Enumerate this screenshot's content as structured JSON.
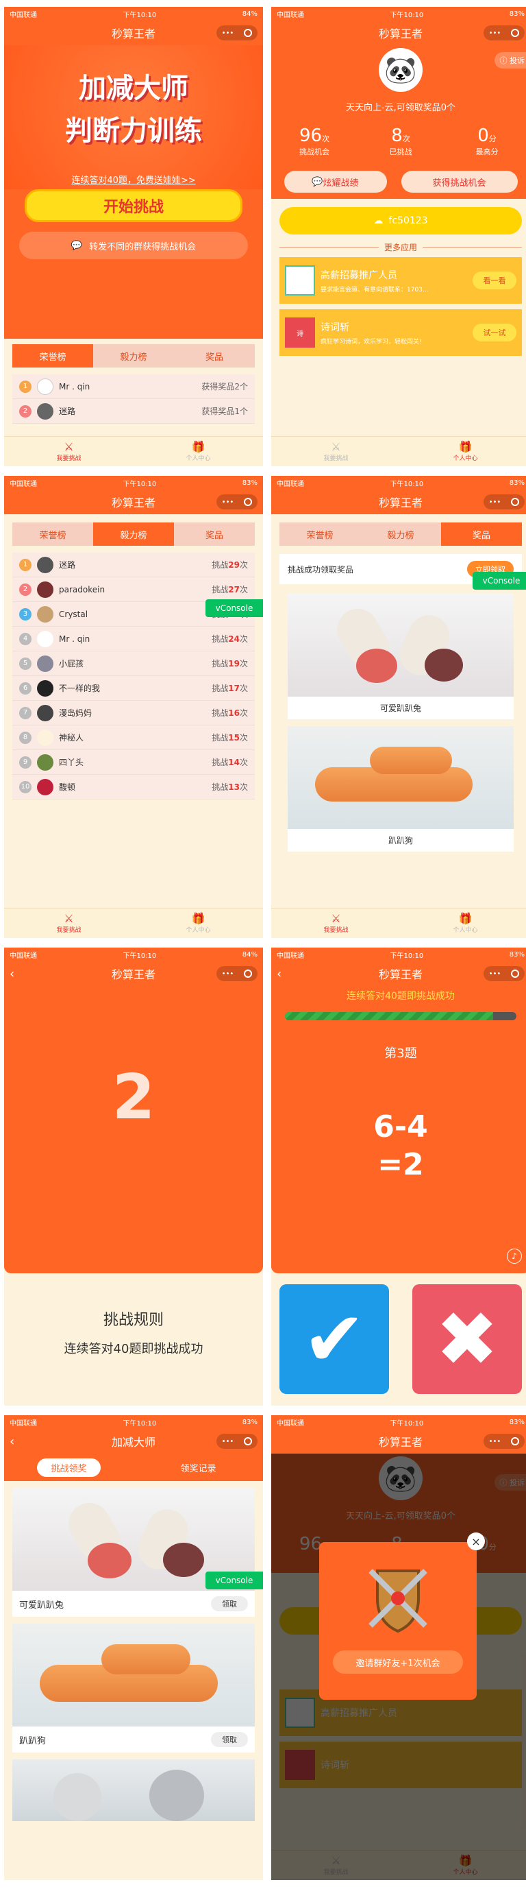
{
  "status": {
    "carrier": "中国联通",
    "time": "下午10:10",
    "bat84": "84%",
    "bat83": "83%"
  },
  "app_title": "秒算王者",
  "app_title_alt": "加减大师",
  "caps_dots": "•••",
  "s1": {
    "hero_title1": "加减大师",
    "hero_title2": "判断力训练",
    "promo_link": "连续答对40题，免费送娃娃>>",
    "start_btn": "开始挑战",
    "share_btn": "转发不同的群获得挑战机会",
    "tabs": [
      "荣誉榜",
      "毅力榜",
      "奖品"
    ],
    "rows": [
      {
        "rank": "1",
        "name": "Mr . qin",
        "score": "获得奖品2个"
      },
      {
        "rank": "2",
        "name": "迷路",
        "score": "获得奖品1个"
      }
    ]
  },
  "tabbar": {
    "left": "我要挑战",
    "right": "个人中心"
  },
  "s2": {
    "complaint": "投诉",
    "greeting": "天天向上-云,可领取奖品0个",
    "stats": [
      {
        "num": "96",
        "unit": "次",
        "label": "挑战机会"
      },
      {
        "num": "8",
        "unit": "次",
        "label": "已挑战"
      },
      {
        "num": "0",
        "unit": "分",
        "label": "最高分"
      }
    ],
    "btn_show": "炫耀战绩",
    "btn_get": "获得挑战机会",
    "code": "fc50123",
    "more_apps": "更多应用",
    "apps": [
      {
        "name": "高薪招募推广人员",
        "desc": "要求能言会道、有意向请联系：1703...",
        "btn": "看一看",
        "icon": "app-logo-icon"
      },
      {
        "name": "诗词斩",
        "desc": "疯狂学习诗词，欢乐学习，轻松闯关!",
        "btn": "试一试",
        "icon": "poem-logo-icon"
      }
    ]
  },
  "s3": {
    "tabs": [
      "荣誉榜",
      "毅力榜",
      "奖品"
    ],
    "rows": [
      {
        "rank": "1",
        "name": "迷路",
        "pre": "挑战",
        "n": "29",
        "suf": "次",
        "color": "#f5a64a"
      },
      {
        "rank": "2",
        "name": "paradokein",
        "pre": "挑战",
        "n": "27",
        "suf": "次",
        "color": "#f47d7d"
      },
      {
        "rank": "3",
        "name": "Crystal",
        "pre": "挑战",
        "n": "25",
        "suf": "次",
        "color": "#4fb3e8"
      },
      {
        "rank": "4",
        "name": "Mr . qin",
        "pre": "挑战",
        "n": "24",
        "suf": "次",
        "color": "#bbb"
      },
      {
        "rank": "5",
        "name": "小屁孩",
        "pre": "挑战",
        "n": "19",
        "suf": "次",
        "color": "#bbb"
      },
      {
        "rank": "6",
        "name": "不一样的我",
        "pre": "挑战",
        "n": "17",
        "suf": "次",
        "color": "#bbb"
      },
      {
        "rank": "7",
        "name": "漫岛妈妈",
        "pre": "挑战",
        "n": "16",
        "suf": "次",
        "color": "#bbb"
      },
      {
        "rank": "8",
        "name": "神秘人",
        "pre": "挑战",
        "n": "15",
        "suf": "次",
        "color": "#bbb"
      },
      {
        "rank": "9",
        "name": "四丫头",
        "pre": "挑战",
        "n": "14",
        "suf": "次",
        "color": "#bbb"
      },
      {
        "rank": "10",
        "name": "馥顿",
        "pre": "挑战",
        "n": "13",
        "suf": "次",
        "color": "#bbb"
      }
    ],
    "vconsole": "vConsole"
  },
  "s4": {
    "tabs": [
      "荣誉榜",
      "毅力榜",
      "奖品"
    ],
    "banner": "挑战成功领取奖品",
    "banner_btn": "立即领取",
    "prizes": [
      "可爱趴趴兔",
      "趴趴狗"
    ],
    "vconsole": "vConsole"
  },
  "s5": {
    "countdown": "2",
    "rules_title": "挑战规则",
    "rules_text": "连续答对40题即挑战成功"
  },
  "s6": {
    "hint": "连续答对40题即挑战成功",
    "progress": 0.9,
    "q_label": "第3题",
    "expr1": "6-4",
    "expr2": "=2"
  },
  "s7": {
    "tabs": [
      "挑战领奖",
      "领奖记录"
    ],
    "items": [
      {
        "name": "可爱趴趴兔",
        "btn": "领取"
      },
      {
        "name": "趴趴狗",
        "btn": "领取"
      }
    ],
    "vconsole": "vConsole"
  },
  "s8": {
    "invite": "邀请群好友+1次机会"
  }
}
